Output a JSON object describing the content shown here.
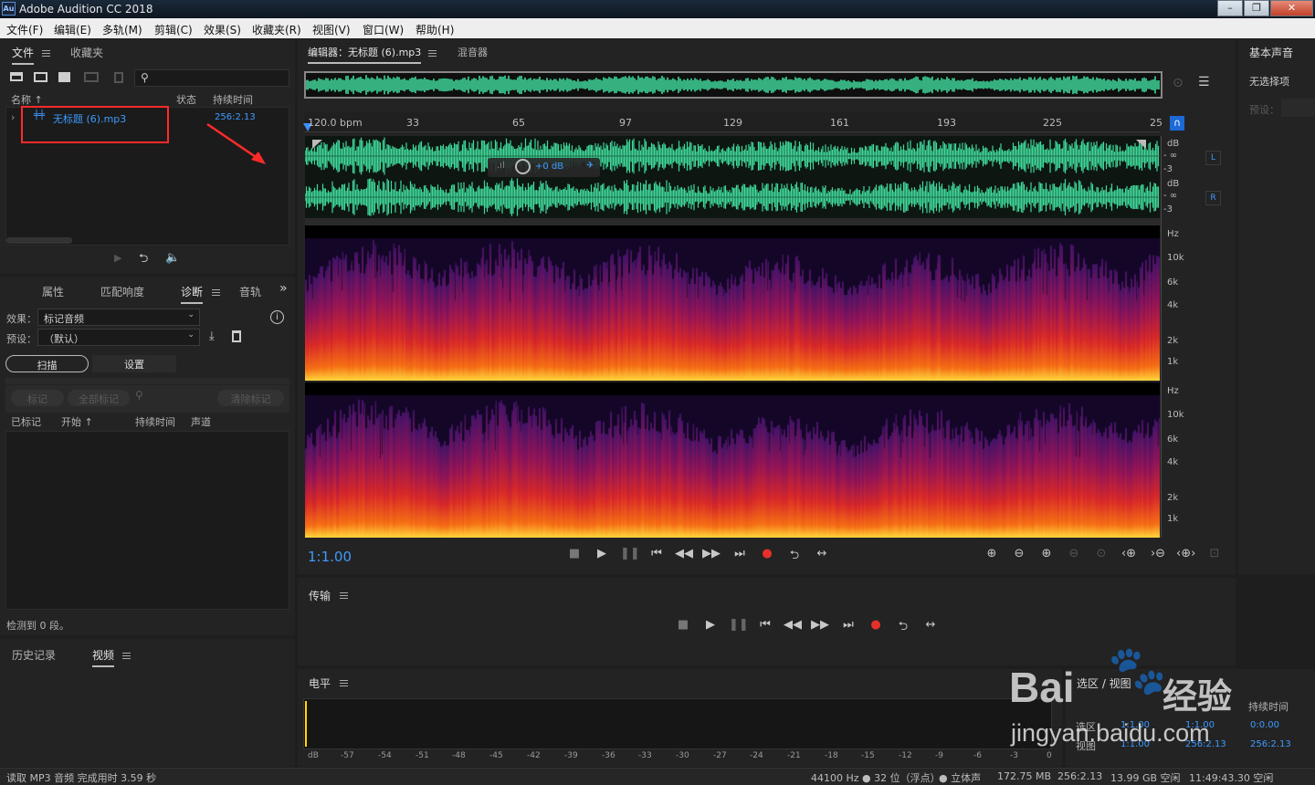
{
  "window": {
    "title": "Adobe Audition CC 2018",
    "app_icon": "Au",
    "min": "–",
    "restore": "❐",
    "close": "✕"
  },
  "menu": [
    "文件(F)",
    "编辑(E)",
    "多轨(M)",
    "剪辑(C)",
    "效果(S)",
    "收藏夹(R)",
    "视图(V)",
    "窗口(W)",
    "帮助(H)"
  ],
  "files_panel": {
    "tabs": [
      "文件",
      "收藏夹"
    ],
    "columns": {
      "name": "名称 ↑",
      "status": "状态",
      "duration": "持续时间"
    },
    "items": [
      {
        "name": "无标题 (6).mp3",
        "duration": "256:2.13"
      }
    ]
  },
  "diag_panel": {
    "tabs": [
      "属性",
      "匹配响度",
      "诊断",
      "音轨"
    ],
    "effect_label": "效果：",
    "effect_value": "标记音频",
    "preset_label": "预设：",
    "preset_value": "（默认）",
    "scan_btn": "扫描",
    "settings_btn": "设置",
    "mark_btn": "标记",
    "mark_all_btn": "全部标记",
    "clear_btn": "清除标记",
    "columns": {
      "marked": "已标记",
      "start": "开始 ↑",
      "duration": "持续时间",
      "channel": "声道"
    },
    "status": "检测到 0 段。"
  },
  "history_panel": {
    "tabs": [
      "历史记录",
      "视频"
    ]
  },
  "editor": {
    "tabs": [
      "编辑器：无标题 (6).mp3",
      "混音器"
    ],
    "ruler": {
      "bpm": "120.0 bpm",
      "marks": [
        "33",
        "65",
        "97",
        "129",
        "161",
        "193",
        "225",
        "25"
      ]
    },
    "hud": {
      "db": "+0 dB"
    },
    "wave_scale": {
      "db": "dB",
      "inf": "- ∞",
      "neg3": "-3",
      "L": "L",
      "R": "R"
    },
    "spec_scale": [
      "Hz",
      "10k",
      "6k",
      "4k",
      "2k",
      "1k"
    ],
    "time": "1:1.00"
  },
  "transport": {
    "title": "传输"
  },
  "levels": {
    "title": "电平",
    "scale": [
      "dB",
      "-57",
      "-54",
      "-51",
      "-48",
      "-45",
      "-42",
      "-39",
      "-36",
      "-33",
      "-30",
      "-27",
      "-24",
      "-21",
      "-18",
      "-15",
      "-12",
      "-9",
      "-6",
      "-3",
      "0"
    ]
  },
  "essential_panel": {
    "title": "基本声音",
    "no_selection": "无选择项",
    "preset_label": "预设："
  },
  "selection_panel": {
    "title": "选区 / 视图",
    "header": {
      "duration": "持续时间"
    },
    "sel_row": {
      "label": "选区",
      "start": "1:1.00",
      "end": "1:1.00",
      "dur": "0:0.00"
    },
    "view_row": {
      "label": "视图",
      "start": "1:1.00",
      "end": "256:2.13",
      "dur": "256:2.13"
    }
  },
  "statusbar": {
    "left": "读取 MP3 音频 完成用时 3.59 秒",
    "rate": "44100 Hz ● 32 位（浮点）",
    "stereo": "● 立体声",
    "size": "172.75 MB",
    "duration": "256:2.13",
    "free": "13.99 GB 空闲",
    "free_time": "11:49:43.30 空闲"
  },
  "watermark": {
    "brand": "Bai",
    "sub": "经验",
    "url": "jingyan.baidu.com"
  },
  "colors": {
    "wave": "#3fd99a",
    "accent_blue": "#3d9bff",
    "record_red": "#e8302a",
    "annotation_red": "#ff2a2a"
  }
}
